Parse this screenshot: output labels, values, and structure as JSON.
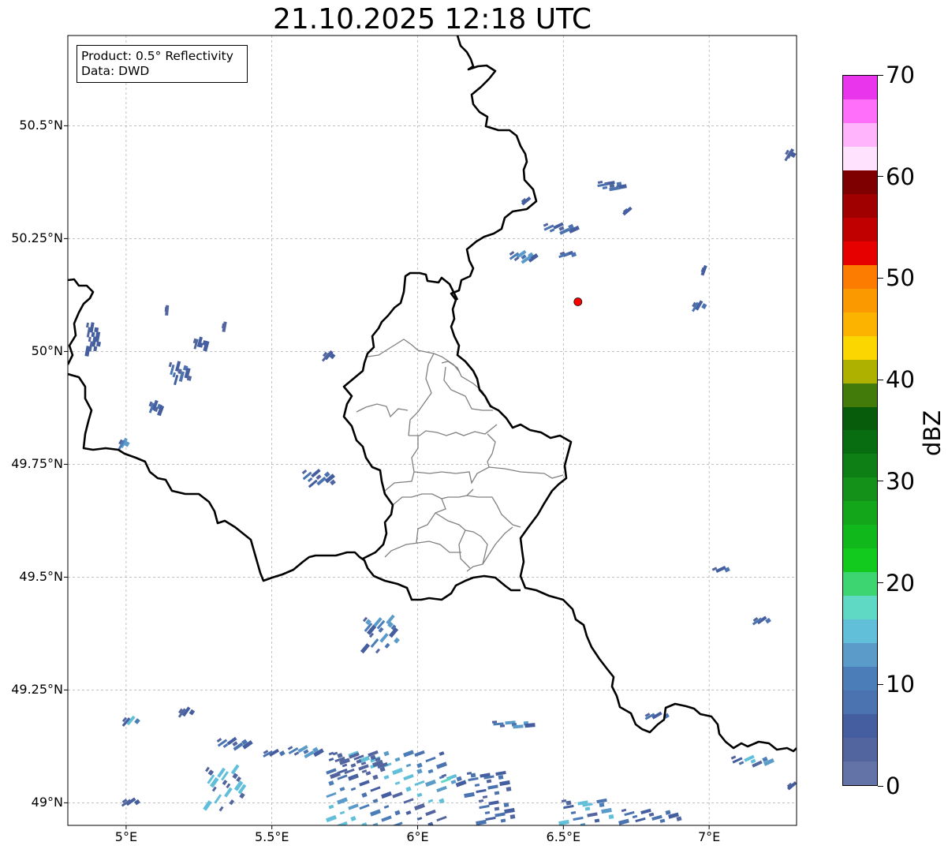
{
  "title": "21.10.2025 12:18 UTC",
  "info_box": {
    "product": "Product: 0.5° Reflectivity",
    "data": "Data: DWD"
  },
  "map": {
    "lon_range": [
      4.8,
      7.3
    ],
    "lat_range": [
      48.95,
      50.7
    ],
    "y_ticks": [
      {
        "lat": 50.5,
        "label": "50.5°N"
      },
      {
        "lat": 50.25,
        "label": "50.25°N"
      },
      {
        "lat": 50.0,
        "label": "50°N"
      },
      {
        "lat": 49.75,
        "label": "49.75°N"
      },
      {
        "lat": 49.5,
        "label": "49.5°N"
      },
      {
        "lat": 49.25,
        "label": "49.25°N"
      },
      {
        "lat": 49.0,
        "label": "49°N"
      }
    ],
    "x_ticks": [
      {
        "lon": 5.0,
        "label": "5°E"
      },
      {
        "lon": 5.5,
        "label": "5.5°E"
      },
      {
        "lon": 6.0,
        "label": "6°E"
      },
      {
        "lon": 6.5,
        "label": "6.5°E"
      },
      {
        "lon": 7.0,
        "label": "7°E"
      }
    ],
    "radar_site": {
      "lon": 6.55,
      "lat": 50.11,
      "color": "#ff0000"
    },
    "border_color": "#000000",
    "district_color": "#808080",
    "grid": true
  },
  "colorbar": {
    "unit": "dBZ",
    "min": 0,
    "max": 70,
    "step": 2.5,
    "colors": [
      "#6373a8",
      "#52659f",
      "#445e9f",
      "#4a73b0",
      "#4b7db9",
      "#5b9bc9",
      "#62bfd9",
      "#5fd8c4",
      "#3dd572",
      "#12c91e",
      "#11b81b",
      "#13a61a",
      "#139118",
      "#0e7f14",
      "#086d10",
      "#075c0c",
      "#437b0b",
      "#afb101",
      "#fcd600",
      "#fbb300",
      "#fb9a00",
      "#fb7c00",
      "#e60000",
      "#c00000",
      "#a00000",
      "#7e0000",
      "#ffe2fd",
      "#ffb4fb",
      "#ff6ffa",
      "#e935eb"
    ],
    "ticks": [
      {
        "value": 0,
        "label": "0"
      },
      {
        "value": 10,
        "label": "10"
      },
      {
        "value": 20,
        "label": "20"
      },
      {
        "value": 30,
        "label": "30"
      },
      {
        "value": 40,
        "label": "40"
      },
      {
        "value": 50,
        "label": "50"
      },
      {
        "value": 60,
        "label": "60"
      },
      {
        "value": 70,
        "label": "70"
      }
    ]
  }
}
